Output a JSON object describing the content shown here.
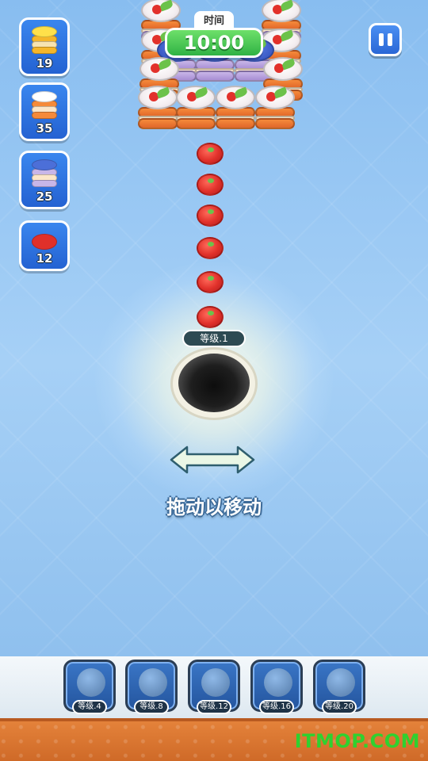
{
  "timer": {
    "label": "时间",
    "value": "10:00"
  },
  "pause": {
    "icon": "pause-icon"
  },
  "goals": [
    {
      "icon": "lemon-cake-icon",
      "count": "19"
    },
    {
      "icon": "strawberry-cake-icon",
      "count": "35"
    },
    {
      "icon": "blueberry-cake-icon",
      "count": "25"
    },
    {
      "icon": "tomato-slice-icon",
      "count": "12"
    }
  ],
  "hole": {
    "level_label": "等级.1"
  },
  "hint": {
    "text": "拖动以移动"
  },
  "powerups": [
    {
      "icon": "vacuum-icon",
      "level": "等级.4"
    },
    {
      "icon": "satellite-dish-icon",
      "level": "等级.8"
    },
    {
      "icon": "magnet-ring-icon",
      "level": "等级.12"
    },
    {
      "icon": "shield-lightning-icon",
      "level": "等级.16"
    },
    {
      "icon": "stopwatch-icon",
      "level": "等级.20"
    }
  ],
  "watermark": "ITMOP.COM",
  "colors": {
    "timer_green": "#2fb244",
    "button_blue": "#2a67d6",
    "ground_orange": "#e4823a"
  }
}
